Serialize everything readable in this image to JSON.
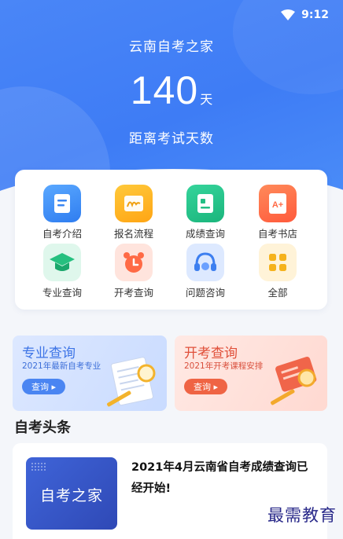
{
  "status": {
    "time": "9:12"
  },
  "header": {
    "app_title": "云南自考之家",
    "countdown_number": "140",
    "countdown_unit": "天",
    "countdown_caption": "距离考试天数"
  },
  "grid": {
    "items": [
      {
        "label": "自考介绍",
        "icon": "document-icon"
      },
      {
        "label": "报名流程",
        "icon": "signature-icon"
      },
      {
        "label": "成绩查询",
        "icon": "scorecard-icon"
      },
      {
        "label": "自考书店",
        "icon": "book-aplus-icon"
      },
      {
        "label": "专业查询",
        "icon": "graduation-cap-icon"
      },
      {
        "label": "开考查询",
        "icon": "alarm-clock-icon"
      },
      {
        "label": "问题咨询",
        "icon": "headset-icon"
      },
      {
        "label": "全部",
        "icon": "grid-all-icon"
      }
    ]
  },
  "banners": {
    "left": {
      "title": "专业查询",
      "subtitle": "2021年最新自考专业",
      "button": "查询 ▸"
    },
    "right": {
      "title": "开考查询",
      "subtitle": "2021年开考课程安排",
      "button": "查询 ▸"
    }
  },
  "news": {
    "section_title": "自考头条",
    "items": [
      {
        "thumb_text": "自考之家",
        "title": "2021年4月云南省自考成绩查询已经开始!"
      }
    ]
  },
  "watermark": "最需教育",
  "colors": {
    "primary": "#3e7cf5",
    "accent_red": "#ef6444"
  }
}
